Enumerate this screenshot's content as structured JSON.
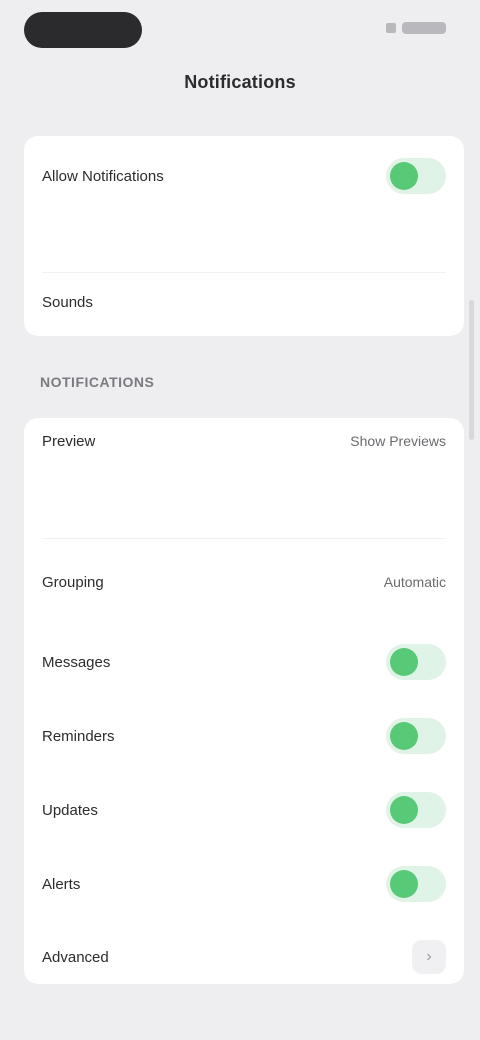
{
  "header": {
    "title": "Notifications"
  },
  "main_card": {
    "primary_toggle": {
      "label": "Allow Notifications",
      "on": true
    },
    "description": "",
    "row": {
      "label": "Sounds"
    }
  },
  "section": {
    "title": "NOTIFICATIONS",
    "rows": [
      {
        "label": "Preview",
        "value": "Show Previews"
      },
      {
        "label": "Grouping",
        "value": "Automatic"
      },
      {
        "label": "Messages",
        "on": true
      },
      {
        "label": "Reminders",
        "on": true
      },
      {
        "label": "Updates",
        "on": true
      },
      {
        "label": "Alerts",
        "on": true
      },
      {
        "label": "Advanced"
      }
    ]
  },
  "colors": {
    "accent": "#58c977",
    "toggle_track": "#dff3e6",
    "background": "#eeeef1"
  },
  "icons": [
    "battery-icon",
    "signal-icon",
    "chevron-right-icon"
  ]
}
